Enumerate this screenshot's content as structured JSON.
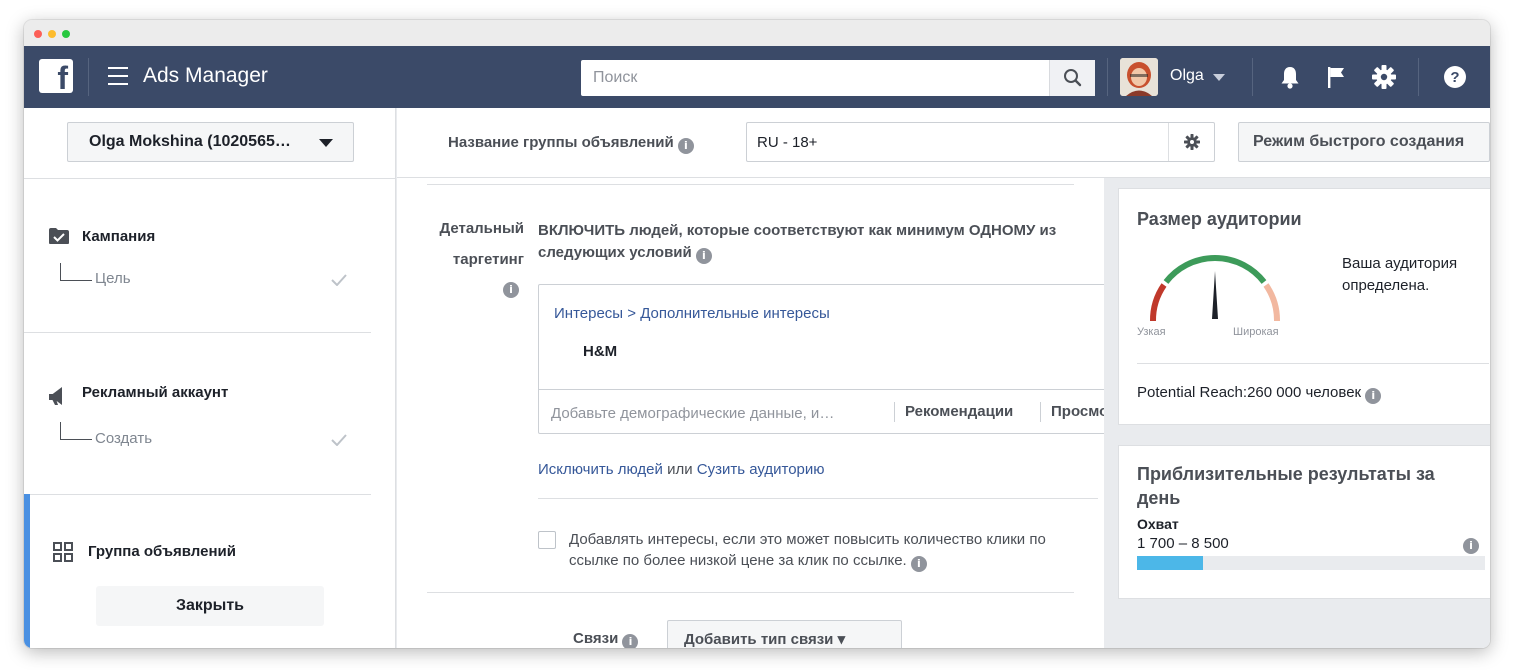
{
  "header": {
    "app_title": "Ads Manager",
    "search_placeholder": "Поиск",
    "user_name": "Olga",
    "colors": {
      "bar": "#3b4a68",
      "accent": "#4a90e2"
    },
    "icons": [
      "facebook-logo-icon",
      "hamburger-icon",
      "search-icon",
      "bell-icon",
      "flag-icon",
      "gear-icon",
      "help-icon"
    ]
  },
  "sidebar": {
    "account_label": "Olga Mokshina (1020565…",
    "campaign": {
      "label": "Кампания",
      "sub": "Цель"
    },
    "ad_account": {
      "label": "Рекламный аккаунт",
      "sub": "Создать"
    },
    "ad_group": {
      "label": "Группа объявлений"
    },
    "close_label": "Закрыть"
  },
  "adset": {
    "name_label": "Название группы объявлений",
    "name_value": "RU - 18+",
    "quick_mode_label": "Режим быстрого создания"
  },
  "targeting": {
    "label_line1": "Детальный",
    "label_line2": "таргетинг",
    "include_text": "ВКЛЮЧИТЬ людей, которые соответствуют как минимум ОДНОМУ из",
    "include_text2": "следующих условий",
    "crumb_category": "Интересы",
    "crumb_sep": " > ",
    "crumb_sub": "Дополнительные интересы",
    "selected_tag": "H&M",
    "input_placeholder": "Добавьте демографические данные, и…",
    "recommendations_label": "Рекомендации",
    "browse_label": "Просмотр",
    "exclude_link": "Исключить людей",
    "or_text": "или",
    "narrow_link": "Сузить аудиторию",
    "expand_checkbox_text1": "Добавлять интересы, если это может повысить количество клики по",
    "expand_checkbox_text2": "ссылке по более низкой цене за клик по ссылке.",
    "connections_label": "Связи",
    "connections_button": "Добавить тип связи"
  },
  "audience": {
    "title": "Размер аудитории",
    "status_line1": "Ваша аудитория",
    "status_line2": "определена.",
    "narrow_label": "Узкая",
    "broad_label": "Широкая",
    "gauge_level": 0.5,
    "reach_label": "Potential Reach:",
    "reach_value": "260 000 человек"
  },
  "estimates": {
    "title": "Приблизительные результаты за день",
    "metric_label": "Охват",
    "metric_range": "1 700 – 8 500",
    "bar_fraction": 0.19
  }
}
